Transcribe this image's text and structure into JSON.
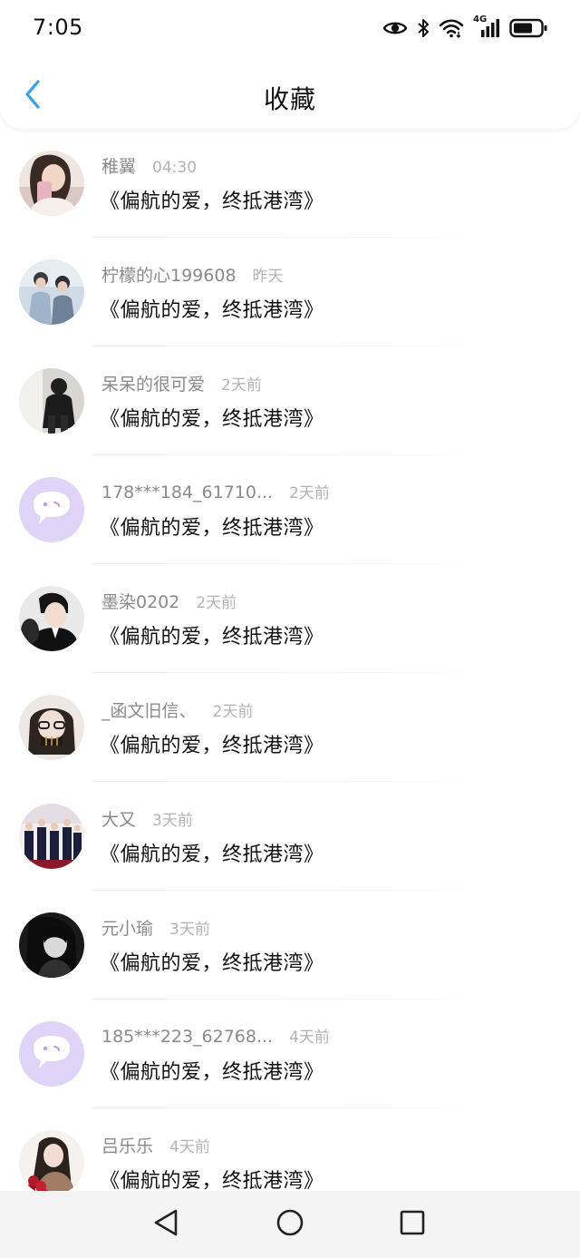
{
  "status_bar": {
    "time": "7:05",
    "network": "4G",
    "icons": [
      "eye-icon",
      "bluetooth-icon",
      "wifi-icon",
      "signal-icon",
      "battery-icon"
    ]
  },
  "header": {
    "title": "收藏",
    "back_icon": "chevron-left-icon",
    "accent_color": "#3aa0e8"
  },
  "items": [
    {
      "name": "稚翼",
      "time": "04:30",
      "content": "《偏航的爱，终抵港湾》",
      "avatar": "photo"
    },
    {
      "name": "柠檬的心199608",
      "time": "昨天",
      "content": "《偏航的爱，终抵港湾》",
      "avatar": "photo"
    },
    {
      "name": "呆呆的很可爱",
      "time": "2天前",
      "content": "《偏航的爱，终抵港湾》",
      "avatar": "photo"
    },
    {
      "name": "178***184_61710...",
      "time": "2天前",
      "content": "《偏航的爱，终抵港湾》",
      "avatar": "default-chat-bubble"
    },
    {
      "name": "墨染0202",
      "time": "2天前",
      "content": "《偏航的爱，终抵港湾》",
      "avatar": "photo"
    },
    {
      "name": "_函文旧信、",
      "time": "2天前",
      "content": "《偏航的爱，终抵港湾》",
      "avatar": "photo"
    },
    {
      "name": "大又",
      "time": "3天前",
      "content": "《偏航的爱，终抵港湾》",
      "avatar": "photo"
    },
    {
      "name": "元小瑜",
      "time": "3天前",
      "content": "《偏航的爱，终抵港湾》",
      "avatar": "photo"
    },
    {
      "name": "185***223_62768...",
      "time": "4天前",
      "content": "《偏航的爱，终抵港湾》",
      "avatar": "default-chat-bubble"
    },
    {
      "name": "吕乐乐",
      "time": "4天前",
      "content": "《偏航的爱，终抵港湾》",
      "avatar": "photo"
    }
  ],
  "nav_bar": {
    "buttons": [
      "back-triangle-icon",
      "home-circle-icon",
      "recents-square-icon"
    ]
  }
}
